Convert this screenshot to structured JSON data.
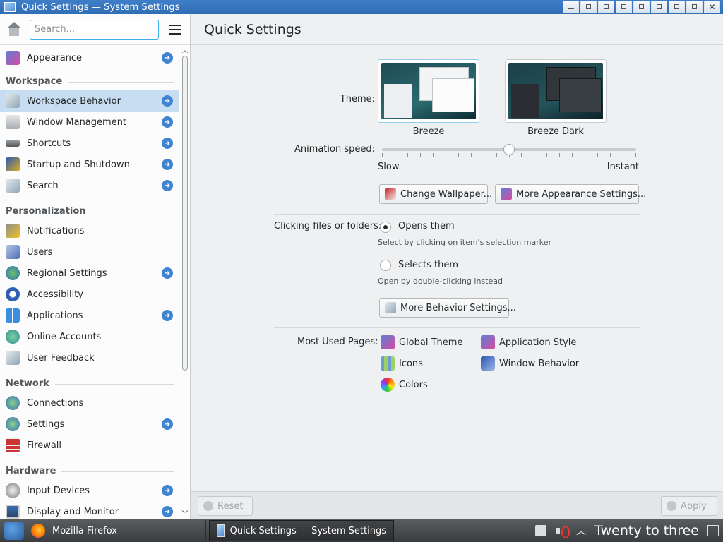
{
  "window": {
    "title": "Quick Settings — System Settings"
  },
  "sidebar": {
    "search_placeholder": "Search...",
    "items": [
      {
        "label": "Appearance",
        "icon": "appearance-icon",
        "arrow": true
      },
      {
        "label": "Workspace Behavior",
        "icon": "workspace-behavior-icon",
        "arrow": true,
        "active": true
      },
      {
        "label": "Window Management",
        "icon": "window-management-icon",
        "arrow": true
      },
      {
        "label": "Shortcuts",
        "icon": "keyboard-icon",
        "arrow": true
      },
      {
        "label": "Startup and Shutdown",
        "icon": "startup-icon",
        "arrow": true
      },
      {
        "label": "Search",
        "icon": "search-settings-icon",
        "arrow": true
      },
      {
        "label": "Notifications",
        "icon": "notifications-icon",
        "arrow": false
      },
      {
        "label": "Users",
        "icon": "users-icon",
        "arrow": false
      },
      {
        "label": "Regional Settings",
        "icon": "globe-icon",
        "arrow": true
      },
      {
        "label": "Accessibility",
        "icon": "accessibility-icon",
        "arrow": false
      },
      {
        "label": "Applications",
        "icon": "applications-icon",
        "arrow": true
      },
      {
        "label": "Online Accounts",
        "icon": "online-accounts-icon",
        "arrow": false
      },
      {
        "label": "User Feedback",
        "icon": "user-feedback-icon",
        "arrow": false
      },
      {
        "label": "Connections",
        "icon": "network-connections-icon",
        "arrow": false
      },
      {
        "label": "Settings",
        "icon": "network-settings-icon",
        "arrow": true
      },
      {
        "label": "Firewall",
        "icon": "firewall-icon",
        "arrow": false
      },
      {
        "label": "Input Devices",
        "icon": "mouse-icon",
        "arrow": true
      },
      {
        "label": "Display and Monitor",
        "icon": "monitor-icon",
        "arrow": true
      }
    ],
    "sections": {
      "workspace": "Workspace",
      "personalization": "Personalization",
      "network": "Network",
      "hardware": "Hardware"
    }
  },
  "main": {
    "title": "Quick Settings",
    "theme_label": "Theme:",
    "themes": [
      {
        "name": "Breeze",
        "selected": true
      },
      {
        "name": "Breeze Dark",
        "selected": false
      }
    ],
    "animation_label": "Animation speed:",
    "animation_min": "Slow",
    "animation_max": "Instant",
    "animation_value": 0.5,
    "change_wallpaper": "Change Wallpaper...",
    "more_appearance": "More Appearance Settings...",
    "clicking_label": "Clicking files or folders:",
    "opens_them": "Opens them",
    "opens_hint": "Select by clicking on item's selection marker",
    "selects_them": "Selects them",
    "selects_hint": "Open by double-clicking instead",
    "click_mode": "opens",
    "more_behavior": "More Behavior Settings...",
    "most_used_label": "Most Used Pages:",
    "most_used": {
      "global_theme": "Global Theme",
      "application_style": "Application Style",
      "icons": "Icons",
      "window_behavior": "Window Behavior",
      "colors": "Colors"
    },
    "reset": "Reset",
    "apply": "Apply"
  },
  "taskbar": {
    "firefox": "Mozilla Firefox",
    "active_task": "Quick Settings — System Settings",
    "clock": "Twenty to three"
  },
  "colors": {
    "accent": "#3daee9",
    "selection": "#c7def2",
    "arrow": "#3e84d1"
  }
}
